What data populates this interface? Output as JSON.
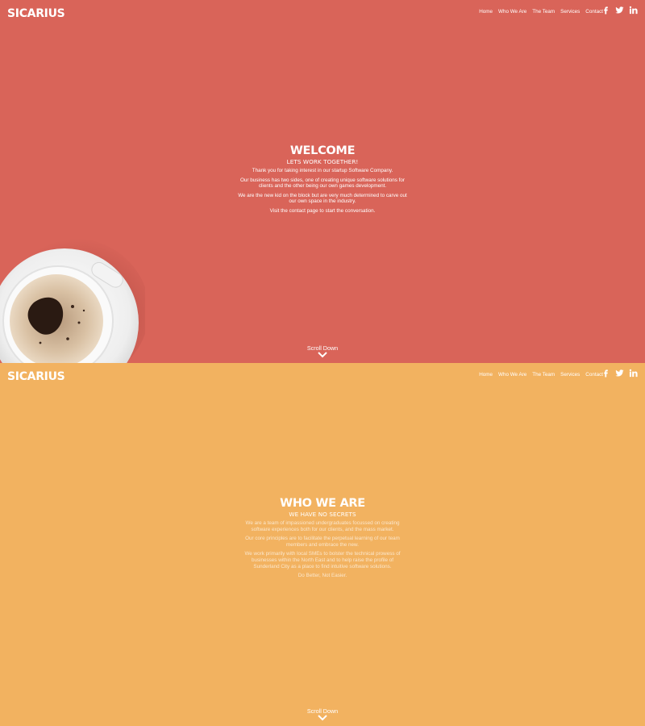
{
  "brand": "SICARIUS",
  "nav": [
    "Home",
    "Who We Are",
    "The Team",
    "Services",
    "Contact"
  ],
  "social_icons": [
    "facebook-icon",
    "twitter-icon",
    "linkedin-icon"
  ],
  "colors": {
    "hero_bg": "#d96459",
    "about_bg": "#f2b260"
  },
  "hero": {
    "title": "WELCOME",
    "subtitle": "LETS WORK TOGETHER!",
    "paragraphs": [
      "Thank you for taking interest in our startup Software Company.",
      "Our business has two sides, one of creating unique software solutions for clients and the other being our own games development.",
      "We are the new kid on the block but are very much determined to carve out our own space in the industry.",
      "Visit the contact page to start the conversation."
    ],
    "scroll_label": "Scroll Down"
  },
  "about": {
    "title": "WHO WE ARE",
    "subtitle": "WE HAVE NO SECRETS",
    "paragraphs": [
      "We are a team of impassioned undergraduates focussed on creating software experiences both for our clients, and the mass market.",
      "Our core principles are to facilitate the perpetual learning of our team members and embrace the new.",
      "We work primarily with local SMEs to bolster the technical prowess of businesses within the North East and to help raise the profile of Sunderland City as a place to find intuitive software solutions.",
      "Do Better, Not Easier."
    ],
    "scroll_label": "Scroll Down"
  }
}
